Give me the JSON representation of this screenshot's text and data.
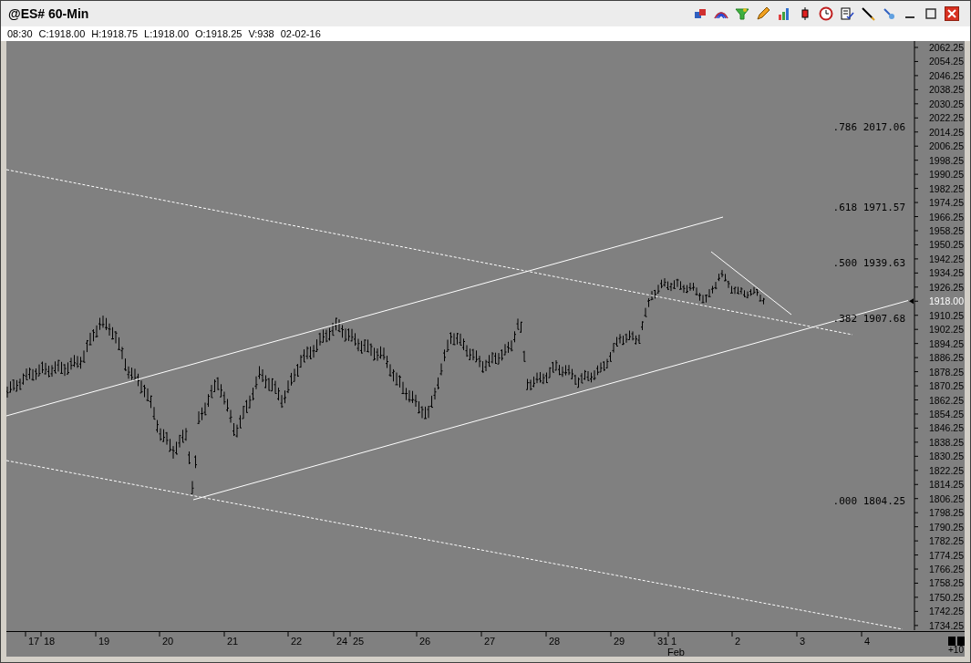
{
  "window": {
    "title": "@ES# 60-Min"
  },
  "quote": [
    "08:30",
    "C:1918.00",
    "H:1918.75",
    "L:1918.00",
    "O:1918.25",
    "V:938",
    "02-02-16"
  ],
  "price_axis": {
    "labels": [
      {
        "text": "2062.25",
        "current": false
      },
      {
        "text": "2054.25",
        "current": false
      },
      {
        "text": "2046.25",
        "current": false
      },
      {
        "text": "2038.25",
        "current": false
      },
      {
        "text": "2030.25",
        "current": false
      },
      {
        "text": "2022.25",
        "current": false
      },
      {
        "text": "2014.25",
        "current": false
      },
      {
        "text": "2006.25",
        "current": false
      },
      {
        "text": "1998.25",
        "current": false
      },
      {
        "text": "1990.25",
        "current": false
      },
      {
        "text": "1982.25",
        "current": false
      },
      {
        "text": "1974.25",
        "current": false
      },
      {
        "text": "1966.25",
        "current": false
      },
      {
        "text": "1958.25",
        "current": false
      },
      {
        "text": "1950.25",
        "current": false
      },
      {
        "text": "1942.25",
        "current": false
      },
      {
        "text": "1934.25",
        "current": false
      },
      {
        "text": "1926.25",
        "current": false
      },
      {
        "text": "1918.00",
        "current": true
      },
      {
        "text": "1910.25",
        "current": false
      },
      {
        "text": "1902.25",
        "current": false
      },
      {
        "text": "1894.25",
        "current": false
      },
      {
        "text": "1886.25",
        "current": false
      },
      {
        "text": "1878.25",
        "current": false
      },
      {
        "text": "1870.25",
        "current": false
      },
      {
        "text": "1862.25",
        "current": false
      },
      {
        "text": "1854.25",
        "current": false
      },
      {
        "text": "1846.25",
        "current": false
      },
      {
        "text": "1838.25",
        "current": false
      },
      {
        "text": "1830.25",
        "current": false
      },
      {
        "text": "1822.25",
        "current": false
      },
      {
        "text": "1814.25",
        "current": false
      },
      {
        "text": "1806.25",
        "current": false
      },
      {
        "text": "1798.25",
        "current": false
      },
      {
        "text": "1790.25",
        "current": false
      },
      {
        "text": "1782.25",
        "current": false
      },
      {
        "text": "1774.25",
        "current": false
      },
      {
        "text": "1766.25",
        "current": false
      },
      {
        "text": "1758.25",
        "current": false
      },
      {
        "text": "1750.25",
        "current": false
      },
      {
        "text": "1742.25",
        "current": false
      },
      {
        "text": "1734.25",
        "current": false
      }
    ]
  },
  "fib_levels": [
    {
      "ratio": ".786",
      "price": "2017.06"
    },
    {
      "ratio": ".618",
      "price": "1971.57"
    },
    {
      "ratio": ".500",
      "price": "1939.63"
    },
    {
      "ratio": ".382",
      "price": "1907.68"
    },
    {
      "ratio": ".000",
      "price": "1804.25"
    }
  ],
  "time_axis": {
    "labels": [
      "17",
      "18",
      "19",
      "20",
      "21",
      "22",
      "24",
      "25",
      "26",
      "27",
      "28",
      "29",
      "31",
      "1",
      "2",
      "3",
      "4"
    ],
    "month": "Feb"
  },
  "corner_label": "+10"
}
